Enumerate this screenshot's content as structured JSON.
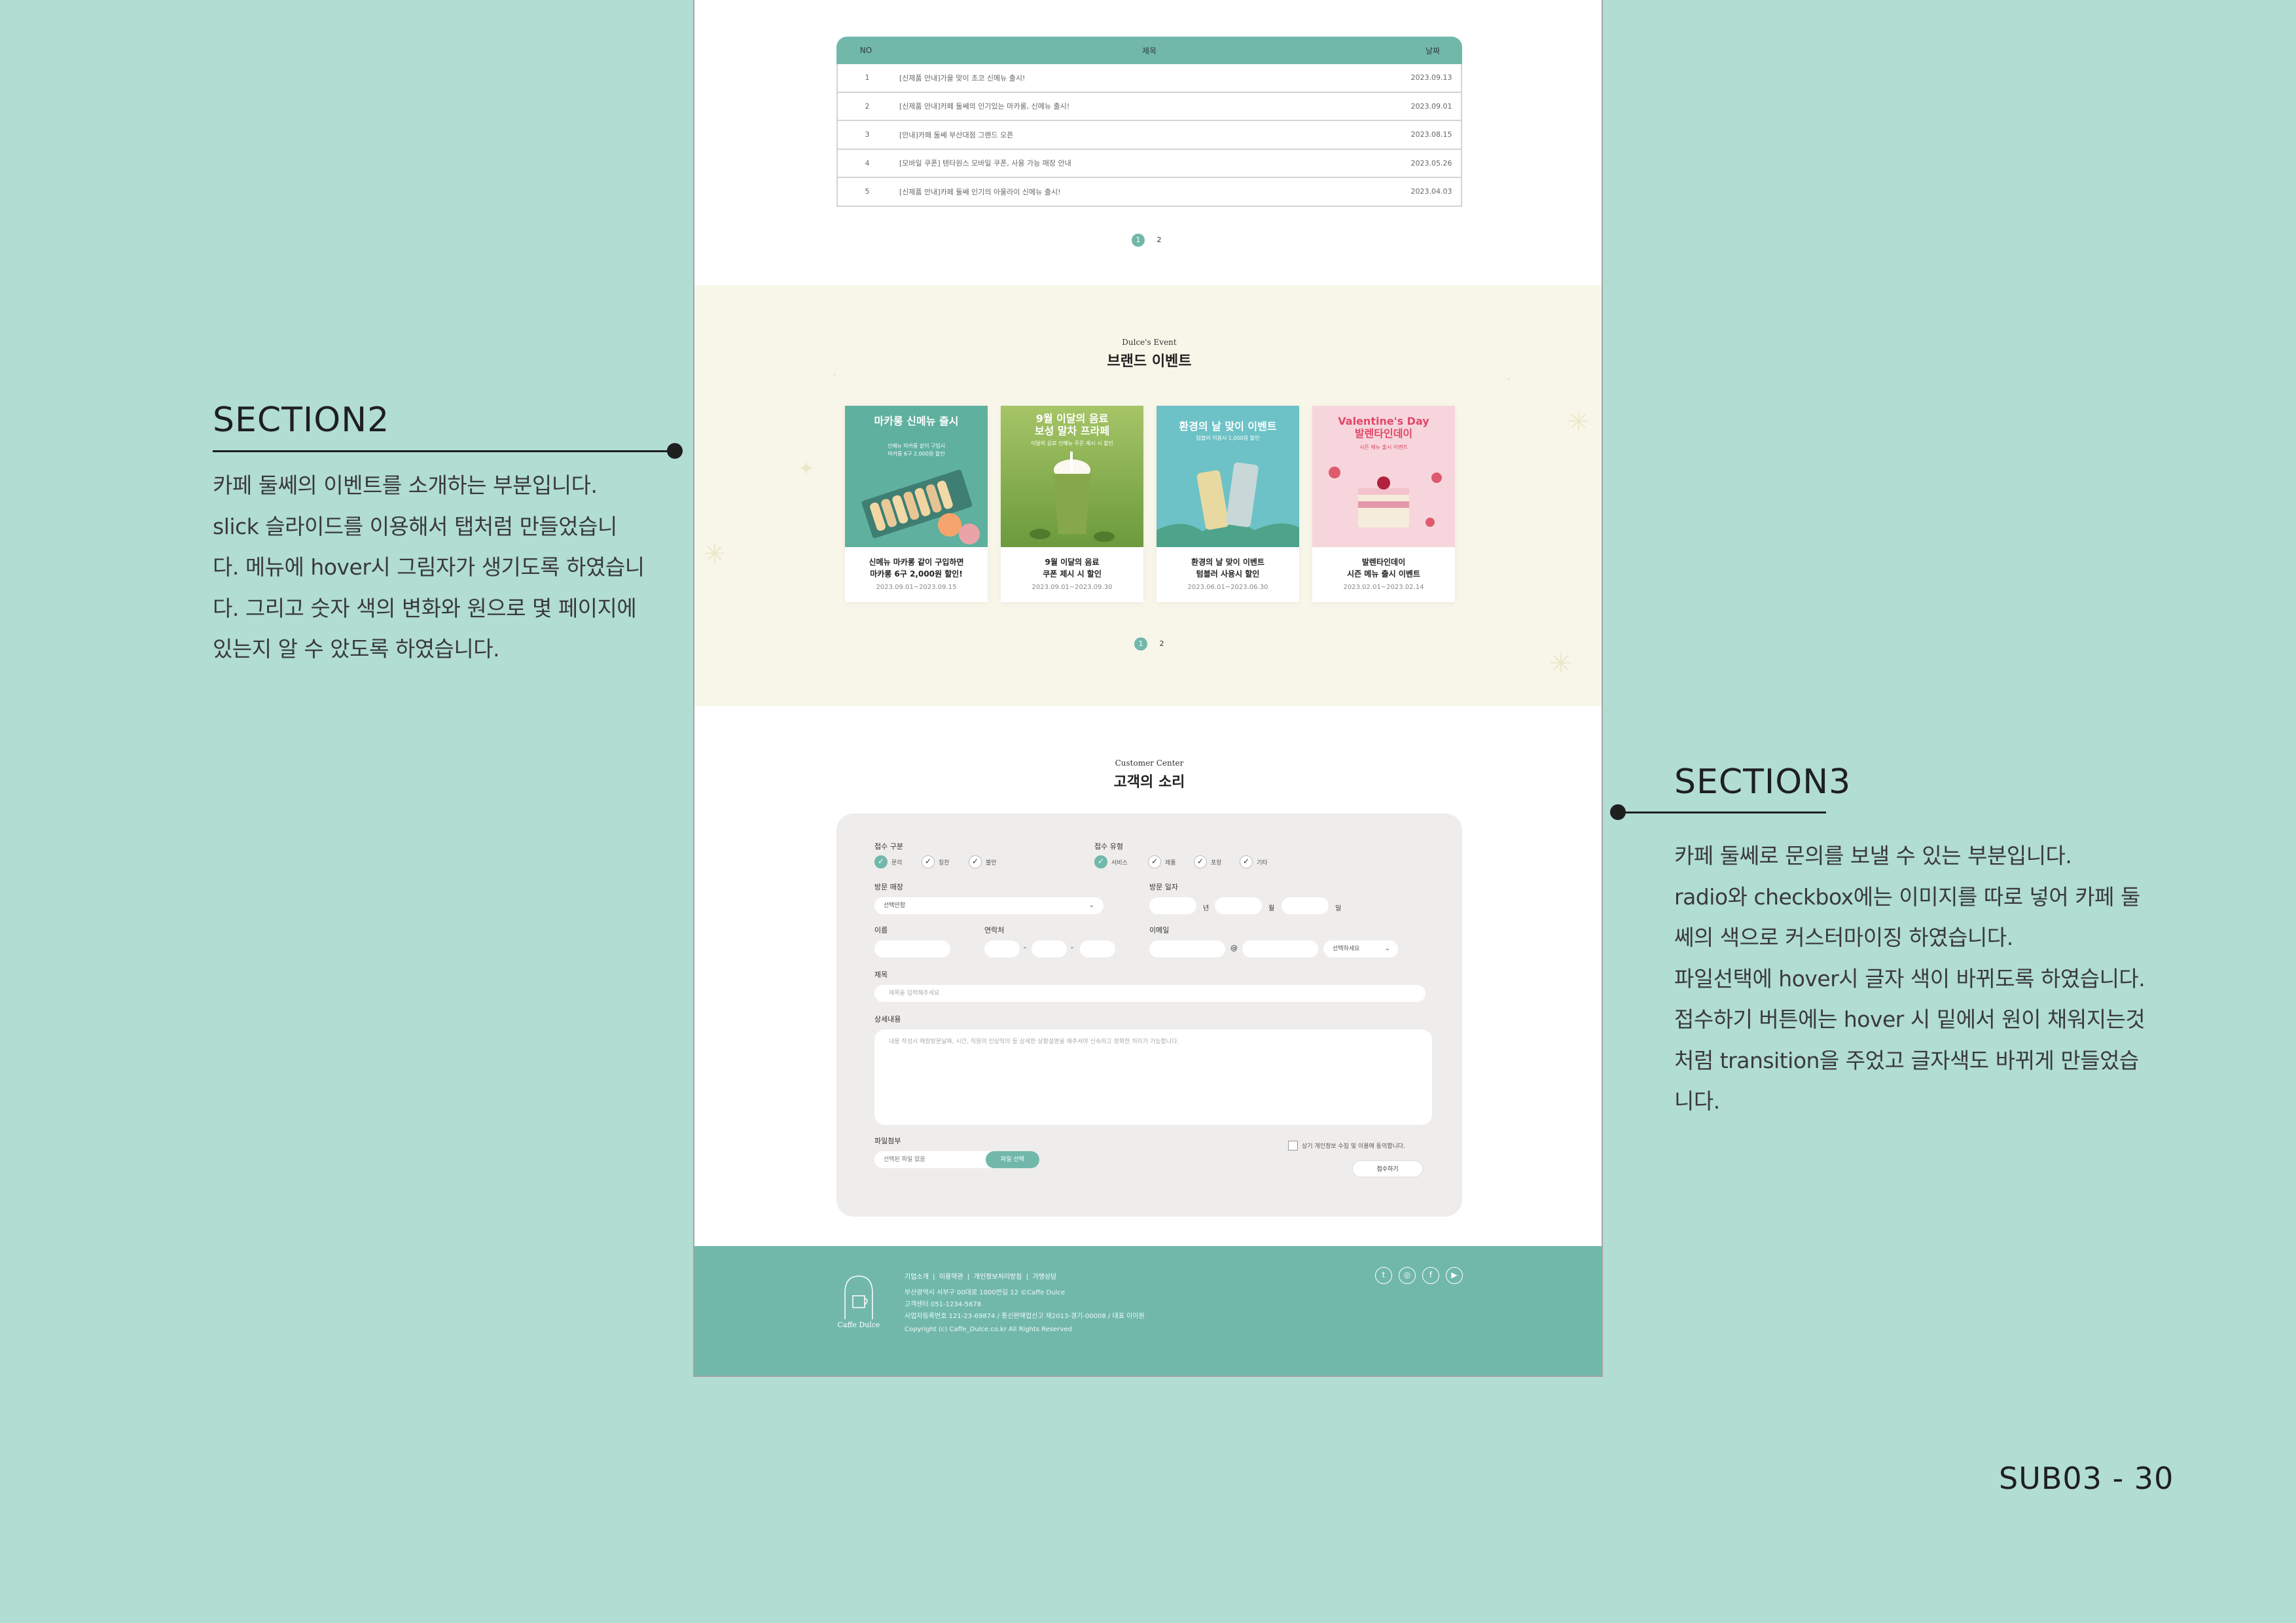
{
  "section2": {
    "title": "SECTION2",
    "lines": [
      "카페 둘쎄의 이벤트를 소개하는 부분입니다.",
      "slick 슬라이드를 이용해서 탭처럼 만들었습니",
      "다. 메뉴에 hover시 그림자가 생기도록 하였습니",
      "다. 그리고 숫자 색의 변화와 원으로 몇 페이지에",
      "있는지 알 수 았도록 하였습니다."
    ]
  },
  "section3": {
    "title": "SECTION3",
    "lines": [
      "카페 둘쎄로 문의를 보낼 수 있는 부분입니다.",
      "radio와 checkbox에는 이미지를 따로 넣어  카페 둘",
      "쎄의 색으로 커스터마이징 하였습니다.",
      "파일선택에 hover시 글자 색이 바뀌도록 하였습니다.",
      "접수하기 버튼에는 hover 시 밑에서 원이 채워지는것",
      "처럼 transition을 주었고 글자색도 바뀌게 만들었습",
      "니다."
    ]
  },
  "page_label": "SUB03 - 30",
  "notice": {
    "headers": {
      "no": "NO",
      "title": "제목",
      "date": "날짜"
    },
    "rows": [
      {
        "no": "1",
        "title": "[신제품 안내]가을 맞이 초코 신메뉴 출시!",
        "date": "2023.09.13"
      },
      {
        "no": "2",
        "title": "[신제품 안내]카페 둘쎄의 인기있는 마카롱, 신메뉴 출시!",
        "date": "2023.09.01"
      },
      {
        "no": "3",
        "title": "[안내]카페 둘쎄 부산대점 그랜드 오픈",
        "date": "2023.08.15"
      },
      {
        "no": "4",
        "title": "[모바일 쿠폰] 텐타원스 모바일 쿠폰, 사용 가능 매장 안내",
        "date": "2023.05.26"
      },
      {
        "no": "5",
        "title": "[신제품 안내]카페 둘쎄 인기의 아울라이 신메뉴 출시!",
        "date": "2023.04.03"
      }
    ],
    "pages": [
      "1",
      "2"
    ]
  },
  "event": {
    "subtitle": "Dulce's Event",
    "title": "브랜드 이벤트",
    "cards": [
      {
        "img_title": "마카롱 신메뉴 출시",
        "img_sub": "신메뉴 마카롱 같이 구입시\n마카롱 6구 2,000원 할인",
        "caption": "신메뉴 마카롱 같이 구입하면\n마카롱 6구 2,000원 할인!",
        "date": "2023.09.01~2023.09.15"
      },
      {
        "img_title": "9월 이달의 음료\n보성 말차 프라페",
        "img_sub": "이달의 음료 신메뉴 주문 제시 시 할인",
        "caption": "9월 이달의 음료\n쿠폰 제시 시 할인",
        "date": "2023.09.01~2023.09.30"
      },
      {
        "img_title": "환경의 날 맞이 이벤트",
        "img_sub": "텀블러 이용시 1,000원 할인",
        "caption": "환경의 날 맞이 이벤트\n텀블러 사용시 할인",
        "date": "2023.06.01~2023.06.30"
      },
      {
        "img_title": "Valentine's Day\n발렌타인데이",
        "img_sub": "시즌 메뉴 출시 이벤트",
        "caption": "발렌타인데이\n시즌 메뉴 출시 이벤트",
        "date": "2023.02.01~2023.02.14"
      }
    ],
    "pages": [
      "1",
      "2"
    ]
  },
  "customer": {
    "subtitle": "Customer Center",
    "title": "고객의 소리",
    "labels": {
      "category": "접수 구분",
      "type": "접수 유형",
      "store": "방문 매장",
      "visit_date": "방문 일자",
      "name": "이름",
      "contact": "연락처",
      "email": "이메일",
      "subject": "제목",
      "detail": "상세내용",
      "attachment": "파일첨부"
    },
    "category_options": [
      "문의",
      "칭찬",
      "불만"
    ],
    "type_options": [
      "서비스",
      "제품",
      "포장",
      "기타"
    ],
    "store_select": "선택안함",
    "date_units": [
      "년",
      "월",
      "일"
    ],
    "phone_sep": "-",
    "email_at": "@",
    "email_select": "선택하세요",
    "subject_placeholder": "제목을 입력해주세요",
    "detail_placeholder": "내용 작성시 매장방문날짜, 시간, 직원의 인상착의 등 상세한 상황설명을 해주셔야 신속하고 정확한 처리가 가능합니다.",
    "file_placeholder": "선택된 파일 없음",
    "file_button": "파일 선택",
    "agree": "상기 개인정보 수집 및 이용에 동의합니다.",
    "submit": "접수하기"
  },
  "footer": {
    "nav": "기업소개  |  이용약관  |  개인정보처리방침  |  가맹상담",
    "info": [
      "부산광역시 서부구 00대로 1000번길 12 ©Caffe Dulce",
      "고객센터 051-1234-5678",
      "사업자등록번호 121-23-69874 / 통신판매업신고 제2013-경기-00008 / 대표 이이원",
      "Copyright (c) Caffe_Dulce.co.kr All Rights Reserved"
    ],
    "logo_text": "Caffe Dulce",
    "sns": [
      "twitter-icon",
      "instagram-icon",
      "facebook-icon",
      "youtube-icon"
    ]
  },
  "colors": {
    "bg": "#b1ddd3",
    "accent": "#71b8ab",
    "event_bg": "#f8f6e9",
    "form_bg": "#eeedeb"
  }
}
